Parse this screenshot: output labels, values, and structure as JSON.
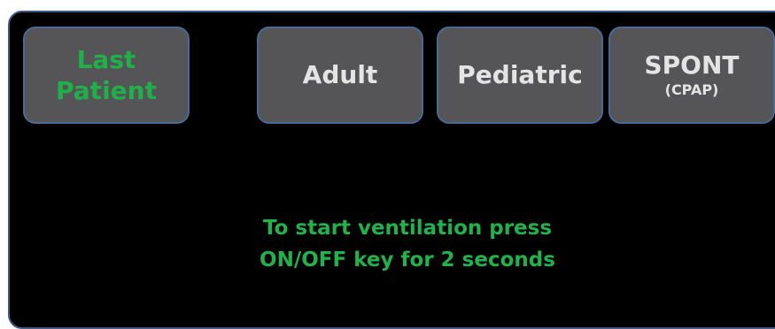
{
  "colors": {
    "background": "#000000",
    "button_fill": "#555557",
    "button_border": "#4a6a96",
    "button_text": "#e4e4e4",
    "accent_green": "#22b24c",
    "frame_border": "#3d5a85"
  },
  "buttons": {
    "last_patient": {
      "line1": "Last",
      "line2": "Patient"
    },
    "adult": {
      "label": "Adult"
    },
    "pediatric": {
      "label": "Pediatric"
    },
    "spont": {
      "label": "SPONT",
      "sub": "(CPAP)"
    }
  },
  "message": {
    "line1": "To start ventilation press",
    "line2": "ON/OFF key for 2 seconds"
  }
}
